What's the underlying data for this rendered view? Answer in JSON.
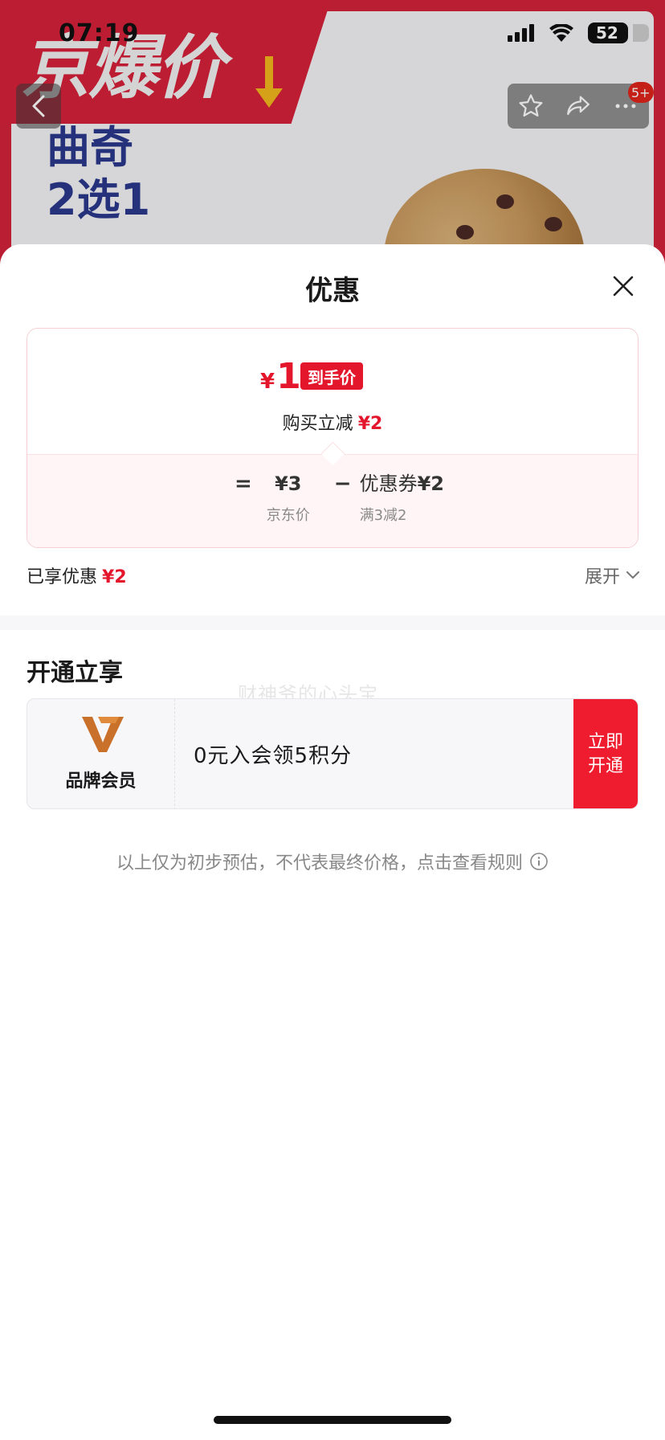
{
  "status_bar": {
    "time": "07:19",
    "battery_level": "52"
  },
  "background_page": {
    "banner_text": "京爆价",
    "product_subtitle": "曲奇\n2选1",
    "cart_badge": "5+"
  },
  "sheet": {
    "title": "优惠",
    "price_card": {
      "final_price_symbol": "¥",
      "final_price": "1",
      "final_price_tag": "到手价",
      "discount_label": "购买立减",
      "discount_amount": "¥2",
      "formula": {
        "equals": "=",
        "base_price": "¥3",
        "base_price_label": "京东价",
        "minus": "−",
        "coupon_label": "优惠券",
        "coupon_amount": "¥2",
        "coupon_rule": "满3减2"
      }
    },
    "enjoyed": {
      "label": "已享优惠",
      "amount": "¥2"
    },
    "expand_label": "展开",
    "open_section": {
      "title": "开通立享",
      "watermark": "财神爷的心头宝",
      "member": {
        "brand_label": "品牌会员",
        "offer_text": "0元入会领5积分",
        "button_label": "立即\n开通"
      }
    },
    "disclaimer": "以上仅为初步预估，不代表最终价格，点击查看规则"
  },
  "colors": {
    "accent_red": "#e4162c",
    "member_button": "#ee1c2e",
    "brand_orange": "#c9702a"
  }
}
